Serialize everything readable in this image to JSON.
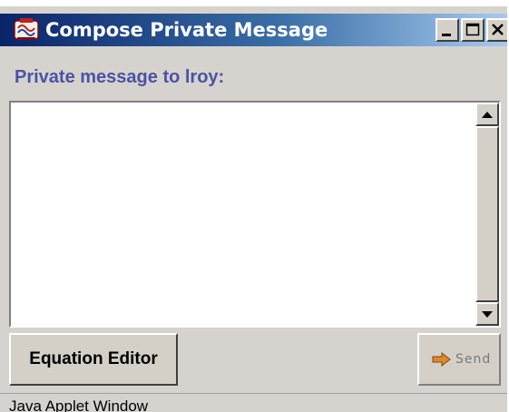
{
  "window": {
    "title": "Compose Private Message",
    "icon": "java-applet-icon"
  },
  "titlebar_buttons": {
    "minimize_icon": "minimize-icon",
    "maximize_icon": "maximize-icon",
    "close_icon": "close-icon"
  },
  "compose": {
    "header": "Private message to lroy:",
    "message_value": ""
  },
  "scrollbar": {
    "up_icon": "arrow-up-icon",
    "down_icon": "arrow-down-icon"
  },
  "buttons": {
    "equation_editor": "Equation Editor",
    "send_label": "Send",
    "send_icon": "arrow-right-icon",
    "send_enabled": false
  },
  "status_bar": {
    "text": "Java Applet Window"
  },
  "colors": {
    "titlebar_start": "#0a246a",
    "titlebar_end": "#a6caf0",
    "header_text": "#4a52a6",
    "send_icon": "#e08830",
    "window_bg": "#d6d3ce"
  }
}
